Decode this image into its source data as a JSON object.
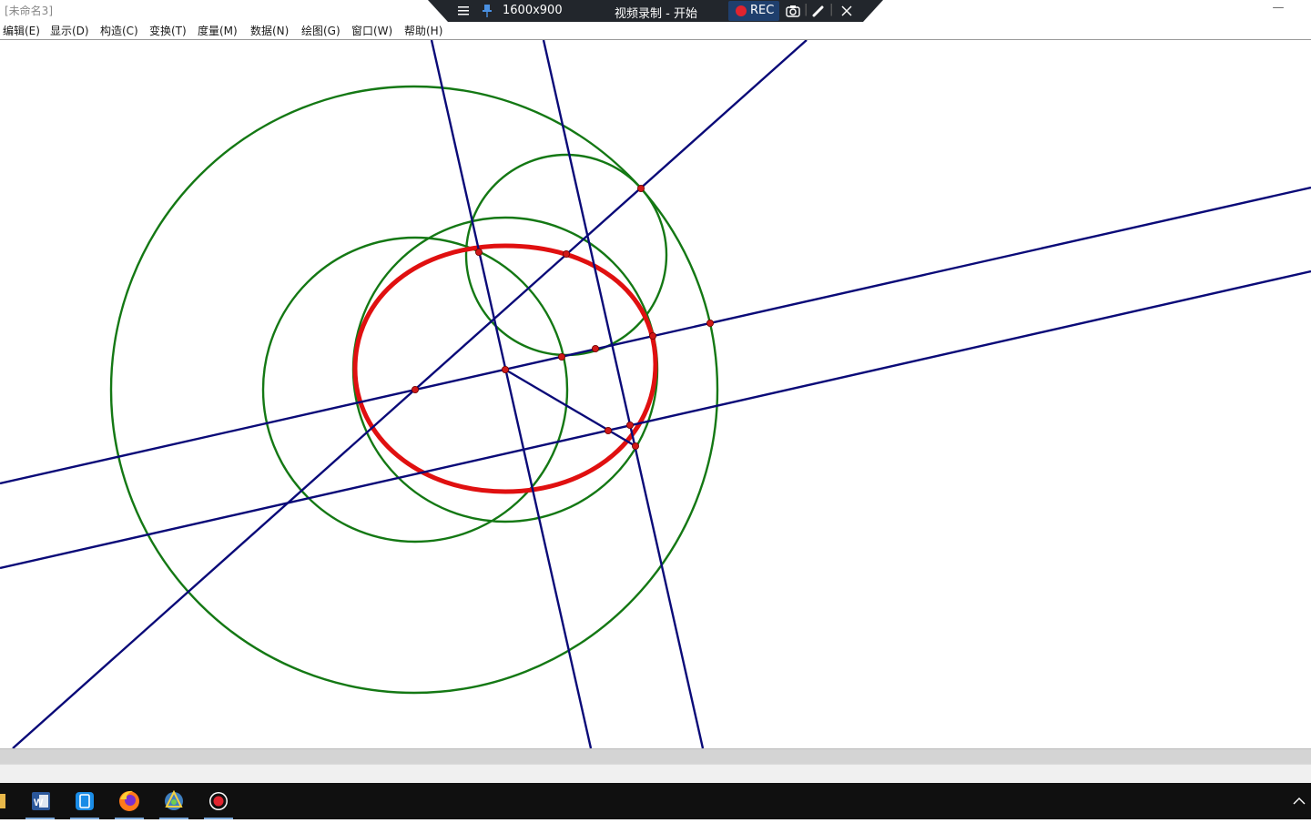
{
  "window": {
    "title": "[未命名3]",
    "minimize_glyph": "—"
  },
  "menu": {
    "items": [
      {
        "label": "编辑(E)"
      },
      {
        "label": "显示(D)"
      },
      {
        "label": "构造(C)"
      },
      {
        "label": "变换(T)"
      },
      {
        "label": "度量(M)"
      },
      {
        "label": "数据(N)"
      },
      {
        "label": "绘图(G)"
      },
      {
        "label": "窗口(W)"
      },
      {
        "label": "帮助(H)"
      }
    ]
  },
  "recorder": {
    "resolution": "1600x900",
    "status": "视频录制 - 开始",
    "rec_label": "REC",
    "icons": [
      "menu-icon",
      "pin-icon",
      "camera-icon",
      "pen-icon",
      "close-icon"
    ]
  },
  "drawing": {
    "circle_color": "#147814",
    "line_color": "#0a0a78",
    "locus_color": "#e01010",
    "point_color": "#d01818"
  },
  "taskbar": {
    "apps": [
      "folder-icon",
      "word-icon",
      "phone-link-icon",
      "firefox-icon",
      "sketchpad-icon",
      "recorder-icon"
    ]
  }
}
